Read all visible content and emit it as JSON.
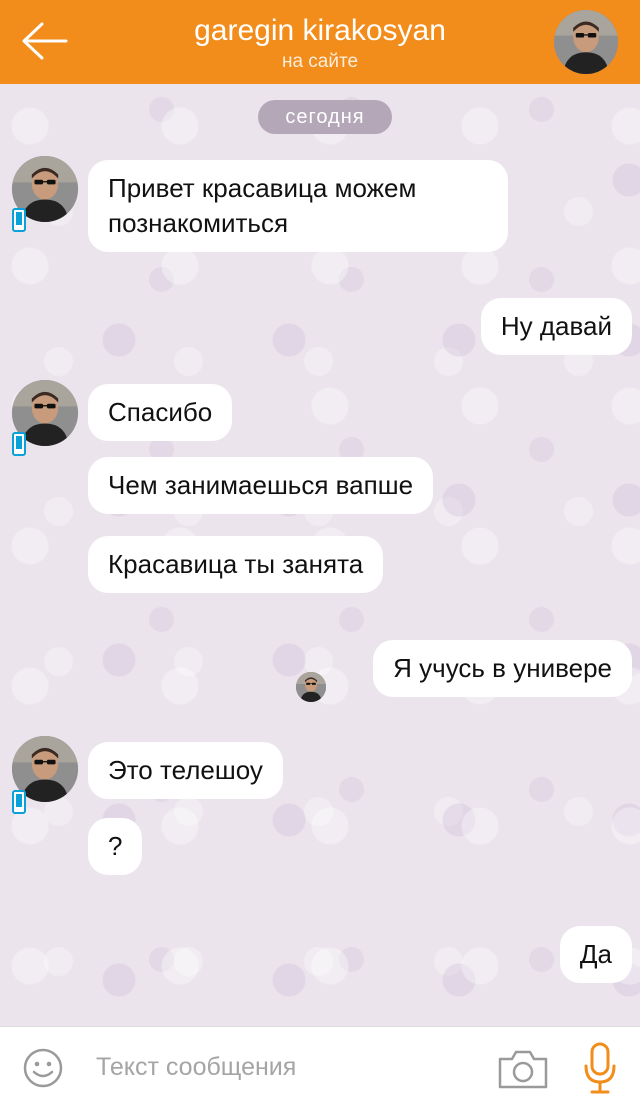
{
  "header": {
    "back_icon": "arrow-left-icon",
    "title": "garegin kirakosyan",
    "status": "на сайте",
    "accent": "#f28c1b"
  },
  "chat": {
    "date_divider": "сегодня",
    "messages": [
      {
        "side": "incoming",
        "text": "Привет красавица можем познакомиться"
      },
      {
        "side": "outgoing",
        "text": "Ну давай"
      },
      {
        "side": "incoming",
        "text": "Спасибо"
      },
      {
        "side": "incoming",
        "text": "Чем занимаешься вапше"
      },
      {
        "side": "incoming",
        "text": "Красавица ты занята"
      },
      {
        "side": "outgoing",
        "text": "Я учусь в универе"
      },
      {
        "side": "incoming",
        "text": "Это телешоу"
      },
      {
        "side": "incoming",
        "text": "?"
      },
      {
        "side": "outgoing",
        "text": "Да"
      }
    ]
  },
  "input_bar": {
    "placeholder": "Текст сообщения",
    "value": "",
    "icons": [
      "smile-icon",
      "camera-icon",
      "microphone-icon"
    ]
  }
}
